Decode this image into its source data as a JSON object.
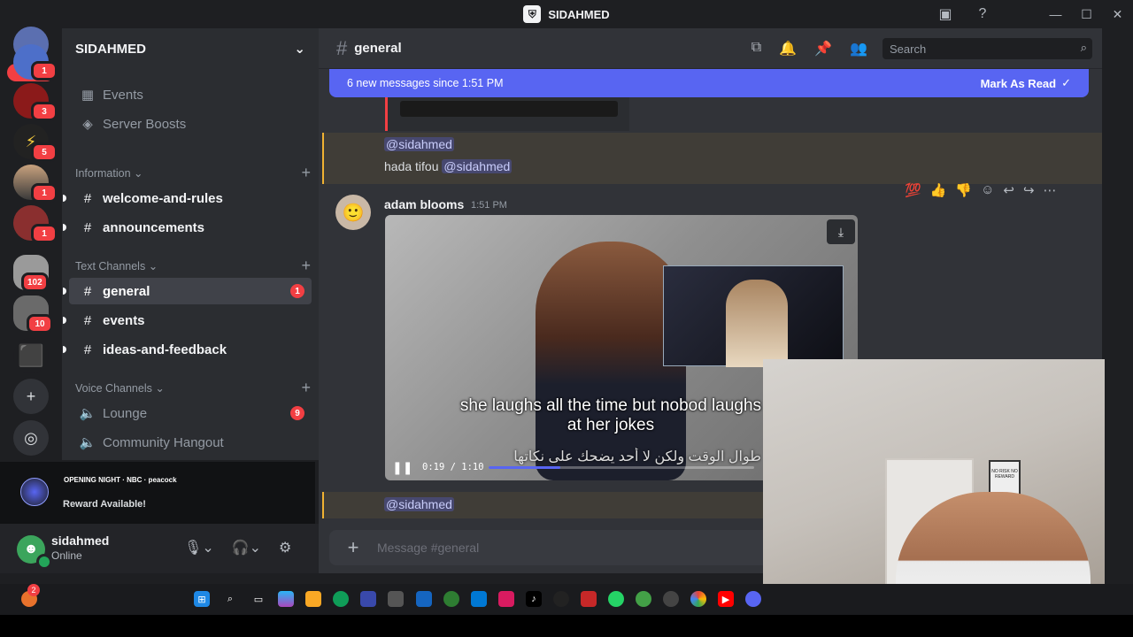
{
  "window": {
    "title": "SIDAHMED",
    "controls": [
      "minimize",
      "maximize",
      "close"
    ]
  },
  "rail": {
    "new_pill": "NEW",
    "servers": [
      {
        "badge": "1",
        "color": "#4d6fc9"
      },
      {
        "badge": "3",
        "color": "#8b1a1a"
      },
      {
        "badge": "5",
        "color": "#222222"
      },
      {
        "badge": "1",
        "color": "#6b5a4a"
      },
      {
        "badge": "1",
        "color": "#8a2f2f"
      },
      {
        "badge": "102",
        "color": "#7a7a7a"
      },
      {
        "badge": "10",
        "color": "#6a6a6a"
      },
      {
        "badge": "",
        "color": "#3ba55c"
      }
    ],
    "add_server": "+",
    "discover": "◎"
  },
  "sidebar": {
    "guild_name": "SIDAHMED",
    "top_items": [
      {
        "label": "Events",
        "icon": "calendar-icon"
      },
      {
        "label": "Server Boosts",
        "icon": "boost-icon"
      }
    ],
    "categories": {
      "information": "Information",
      "text": "Text Channels",
      "voice": "Voice Channels"
    },
    "channels": {
      "welcome": "welcome-and-rules",
      "announcements": "announcements",
      "general": "general",
      "general_badge": "1",
      "events": "events",
      "ideas": "ideas-and-feedback",
      "lounge": "Lounge",
      "lounge_badge": "9",
      "hangout": "Community Hangout"
    }
  },
  "reward": {
    "brands": "OPENING NIGHT · NBC · peacock",
    "text": "Reward Available!"
  },
  "user": {
    "name": "sidahmed",
    "status": "Online"
  },
  "header": {
    "channel": "general",
    "search_placeholder": "Search"
  },
  "newbar": {
    "text": "6 new messages since 1:51 PM",
    "action": "Mark As Read"
  },
  "messages": {
    "mention1": "@sidahmed",
    "reply_text": "hada tifou",
    "mention2": "@sidahmed",
    "author": "adam blooms",
    "time": "1:51 PM",
    "subtitle_en": "she laughs all the time but nobod laughs at her jokes",
    "subtitle_ar": "طوال الوقت ولكن لا أحد يضحك على نكاتها",
    "video_time": "0:19 / 1:10",
    "video_progress": 0.27,
    "mention3": "@sidahmed",
    "reactions": [
      "💯",
      "👍",
      "👎"
    ]
  },
  "composer": {
    "placeholder": "Message #general"
  },
  "webcam": {
    "poster_text": "NO RISK NO REWARD"
  },
  "taskbar": {
    "notif_badge": "2"
  }
}
